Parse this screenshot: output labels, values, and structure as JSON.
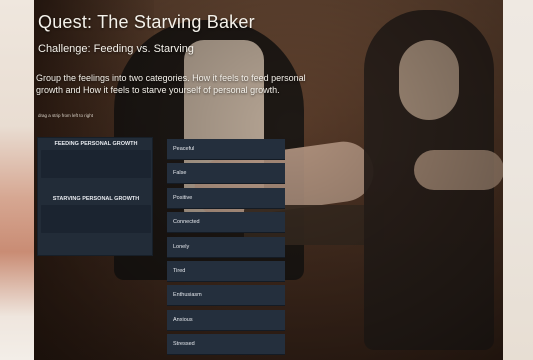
{
  "quest": {
    "title": "Quest: The Starving Baker",
    "challenge": "Challenge: Feeding vs. Starving",
    "instructions": "Group the feelings into two categories. How it feels to feed personal growth and How it feels to starve yourself of personal growth.",
    "hint": "drag a strip from left to right"
  },
  "categories": [
    {
      "label": "FEEDING PERSONAL GROWTH"
    },
    {
      "label": "STARVING PERSONAL GROWTH"
    }
  ],
  "words": [
    "Peaceful",
    "False",
    "Positive",
    "Connected",
    "Lonely",
    "Tired",
    "Enthusiasm",
    "Anxious",
    "Stressed"
  ],
  "colors": {
    "panel": "#222c38",
    "tile": "#242f3d",
    "text": "#f4f1ea"
  }
}
